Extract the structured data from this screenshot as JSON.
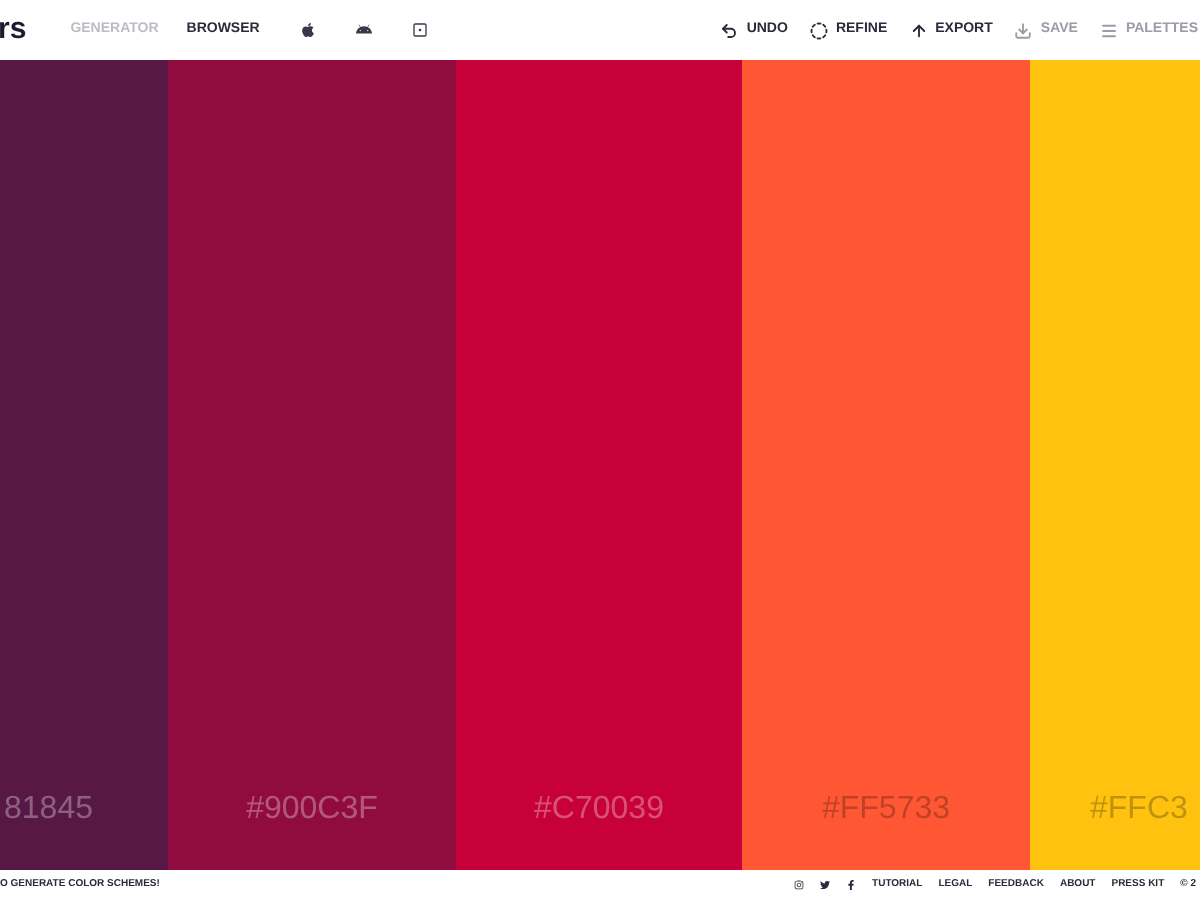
{
  "header": {
    "logo": "rs",
    "nav": [
      {
        "label": "GENERATOR",
        "selected": false
      },
      {
        "label": "BROWSER",
        "selected": true
      }
    ],
    "actions": [
      {
        "label": "UNDO",
        "disabled": false
      },
      {
        "label": "REFINE",
        "disabled": false
      },
      {
        "label": "EXPORT",
        "disabled": false
      },
      {
        "label": "SAVE",
        "disabled": true
      },
      {
        "label": "PALETTES",
        "disabled": true
      }
    ]
  },
  "swatches": [
    {
      "hex": "81845",
      "color": "#581845"
    },
    {
      "hex": "#900C3F",
      "color": "#900c3f"
    },
    {
      "hex": "#C70039",
      "color": "#c70039"
    },
    {
      "hex": "#FF5733",
      "color": "#ff5733"
    },
    {
      "hex": "#FFC3",
      "color": "#ffc30f"
    }
  ],
  "footer": {
    "tagline": "O GENERATE COLOR SCHEMES!",
    "links": [
      "TUTORIAL",
      "LEGAL",
      "FEEDBACK",
      "ABOUT",
      "PRESS KIT"
    ],
    "copyright": "© 2"
  }
}
